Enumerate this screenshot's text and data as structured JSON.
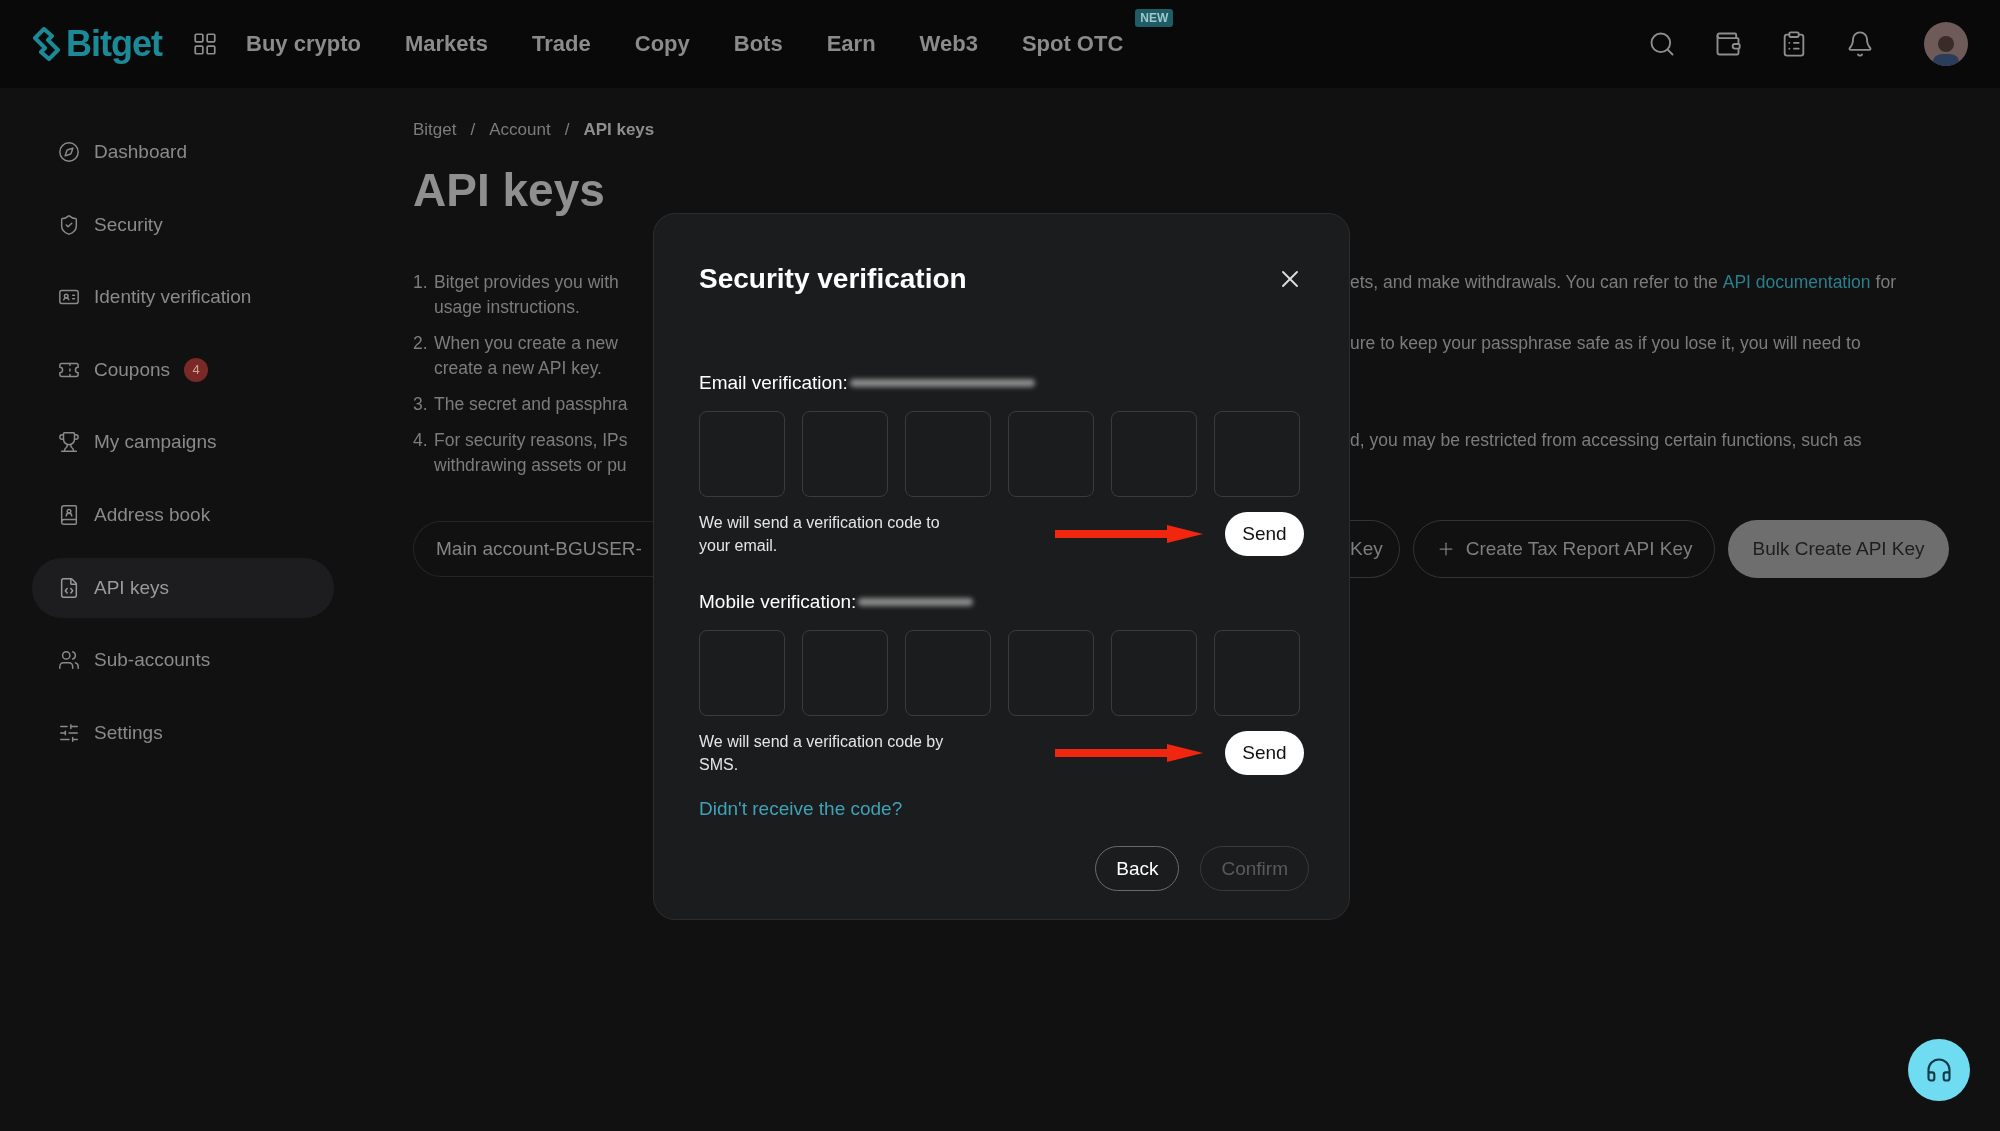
{
  "top_nav": {
    "logo": "Bitget",
    "items": [
      {
        "label": "Buy crypto"
      },
      {
        "label": "Markets"
      },
      {
        "label": "Trade"
      },
      {
        "label": "Copy"
      },
      {
        "label": "Bots"
      },
      {
        "label": "Earn"
      },
      {
        "label": "Web3"
      },
      {
        "label": "Spot OTC",
        "badge": "NEW"
      }
    ]
  },
  "sidebar": {
    "items": [
      {
        "label": "Dashboard",
        "kind": "dashboard",
        "selected": false
      },
      {
        "label": "Security",
        "kind": "security",
        "selected": false
      },
      {
        "label": "Identity verification",
        "kind": "identity",
        "selected": false
      },
      {
        "label": "Coupons",
        "kind": "coupons",
        "selected": false,
        "badge": "4"
      },
      {
        "label": "My campaigns",
        "kind": "campaigns",
        "selected": false
      },
      {
        "label": "Address book",
        "kind": "address",
        "selected": false
      },
      {
        "label": "API keys",
        "kind": "api",
        "selected": true
      },
      {
        "label": "Sub-accounts",
        "kind": "subaccounts",
        "selected": false
      },
      {
        "label": "Settings",
        "kind": "settings",
        "selected": false
      }
    ]
  },
  "breadcrumb": [
    {
      "label": "Bitget",
      "current": false
    },
    {
      "separator": "/",
      "label": "Account",
      "current": false
    },
    {
      "separator": "/",
      "label": "API keys",
      "current": true
    }
  ],
  "page_title": "API keys",
  "notes": [
    {
      "number": "1.",
      "lines": [
        {
          "left": "Bitget provides you with",
          "right": "ets, and make withdrawals. You can refer to the",
          "link": "API documentation",
          "right_end": "for"
        },
        {
          "left": "usage instructions."
        }
      ]
    },
    {
      "number": "2.",
      "lines": [
        {
          "left": "When you create a new",
          "right": "ure to keep your passphrase safe as if you lose it, you will need to"
        },
        {
          "left": "create a new API key."
        }
      ]
    },
    {
      "number": "3.",
      "lines": [
        {
          "left": "The secret and passphra"
        }
      ]
    },
    {
      "number": "4.",
      "lines": [
        {
          "left": "For security reasons, IPs",
          "right": "d, you may be restricted from accessing certain functions, such as"
        },
        {
          "left": "withdrawing assets or pu"
        }
      ]
    }
  ],
  "account_selector": "Main account-BGUSER-",
  "actions": [
    {
      "label": "Key",
      "kind": "cut"
    },
    {
      "label": "Create Tax Report API Key",
      "kind": "add"
    },
    {
      "label": "Bulk Create API Key",
      "kind": "filled"
    }
  ],
  "dialog": {
    "title": "Security verification",
    "sections": [
      {
        "label": "Email verification:",
        "hint": "We will send a verification code to your email.",
        "send": "Send"
      },
      {
        "label": "Mobile verification:",
        "hint": "We will send a verification code by SMS.",
        "send": "Send"
      }
    ],
    "link": "Didn't receive the code?",
    "buttons": [
      {
        "label": "Back",
        "disabled": false
      },
      {
        "label": "Confirm",
        "disabled": true
      }
    ]
  }
}
